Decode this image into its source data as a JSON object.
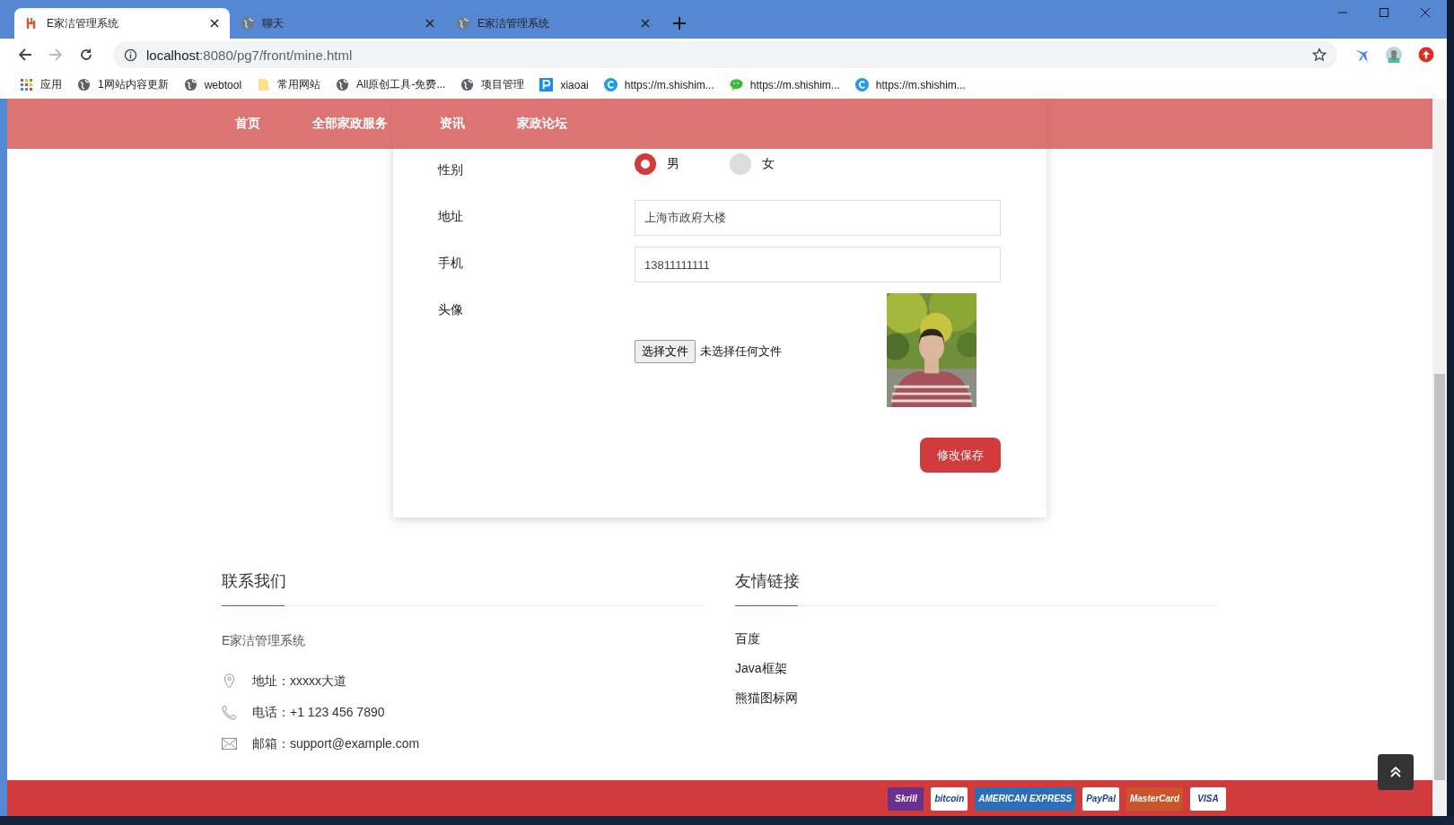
{
  "browser": {
    "tabs": [
      {
        "title": "E家洁管理系统",
        "selected": true,
        "kind": "logo"
      },
      {
        "title": "聊天",
        "selected": false,
        "kind": "globe"
      },
      {
        "title": "E家洁管理系统",
        "selected": false,
        "kind": "globe"
      }
    ],
    "address": {
      "host": "localhost",
      "path": ":8080/pg7/front/mine.html"
    },
    "bookmarks": [
      {
        "label": "应用",
        "kind": "apps"
      },
      {
        "label": "1网站内容更新",
        "kind": "globe"
      },
      {
        "label": "webtool",
        "kind": "globe"
      },
      {
        "label": "常用网站",
        "kind": "folder"
      },
      {
        "label": "All原创工具-免费...",
        "kind": "globe"
      },
      {
        "label": "项目管理",
        "kind": "globe"
      },
      {
        "label": "xiaoai",
        "kind": "p"
      },
      {
        "label": "https://m.shishim...",
        "kind": "c"
      },
      {
        "label": "https://m.shishim...",
        "kind": "chat"
      },
      {
        "label": "https://m.shishim...",
        "kind": "c"
      }
    ]
  },
  "nav": [
    "首页",
    "全部家政服务",
    "资讯",
    "家政论坛"
  ],
  "profile": {
    "fields": [
      {
        "kind": "radio",
        "label": "性别",
        "options": [
          {
            "label": "男",
            "selected": true
          },
          {
            "label": "女",
            "selected": false
          }
        ]
      },
      {
        "kind": "text",
        "label": "地址",
        "value": "上海市政府大楼"
      },
      {
        "kind": "text",
        "label": "手机",
        "value": "13811111111"
      },
      {
        "kind": "file",
        "label": "头像",
        "button": "选择文件",
        "status": "未选择任何文件"
      }
    ],
    "save_button": "修改保存"
  },
  "footer": {
    "contact": {
      "title": "联系我们",
      "company": "E家洁管理系统",
      "items": [
        {
          "kind": "pin",
          "text": "地址：xxxxx大道"
        },
        {
          "kind": "phone",
          "text": "电话：+1 123 456 7890"
        },
        {
          "kind": "mail",
          "text": "邮箱：support@example.com"
        }
      ]
    },
    "links": {
      "title": "友情链接",
      "items": [
        "百度",
        "Java框架",
        "熊猫图标网"
      ]
    },
    "payments": [
      {
        "label": "Skrill",
        "color": "#6b2f8f"
      },
      {
        "label": "bitcoin",
        "color": "#ffffff"
      },
      {
        "label": "AMERICAN EXPRESS",
        "color": "#2d6fb7"
      },
      {
        "label": "PayPal",
        "color": "#ffffff"
      },
      {
        "label": "MasterCard",
        "color": "#c8552b"
      },
      {
        "label": "VISA",
        "color": "#ffffff"
      }
    ]
  }
}
